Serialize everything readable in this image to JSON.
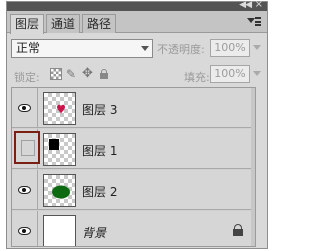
{
  "tabs": [
    {
      "label": "图层",
      "active": true
    },
    {
      "label": "通道",
      "active": false
    },
    {
      "label": "路径",
      "active": false
    }
  ],
  "blend_mode": "正常",
  "opacity": {
    "label": "不透明度:",
    "value": "100%"
  },
  "lock_label": "锁定:",
  "fill": {
    "label": "填充:",
    "value": "100%"
  },
  "layers": [
    {
      "name": "图层 3",
      "visible": true,
      "content": "heart",
      "color": "#c8164a"
    },
    {
      "name": "图层 1",
      "visible": false,
      "content": "square",
      "color": "#000000"
    },
    {
      "name": "图层 2",
      "visible": true,
      "content": "ellipse",
      "color": "#0e6a12"
    },
    {
      "name": "背景",
      "visible": true,
      "content": "white",
      "locked": true
    }
  ],
  "icons": {
    "collapse": "double-chevron-right-icon",
    "close": "close-icon",
    "panel_menu": "panel-menu-icon",
    "lock_transparent": "lock-transparent-pixels-icon",
    "lock_image": "brush-icon",
    "lock_position": "move-icon",
    "lock_all": "lock-icon",
    "visibility": "eye-icon"
  }
}
